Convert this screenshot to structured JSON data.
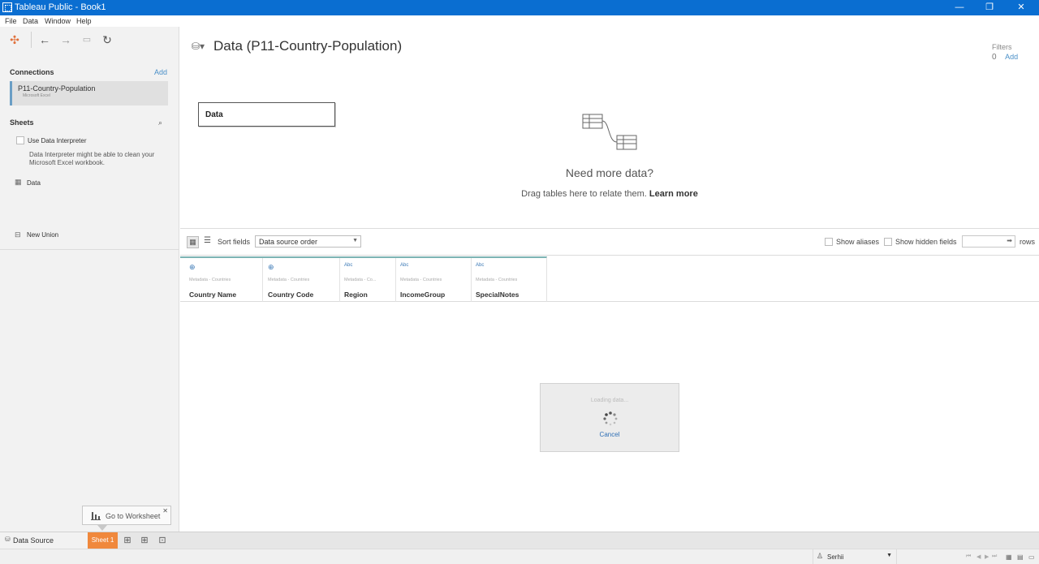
{
  "window": {
    "title": "Tableau Public - Book1",
    "minimize": "—",
    "restore": "❐",
    "close": "✕"
  },
  "menu": [
    "File",
    "Data",
    "Window",
    "Help"
  ],
  "left": {
    "connections_title": "Connections",
    "add_label": "Add",
    "connection": {
      "name": "P11-Country-Population",
      "type": "Microsoft Excel"
    },
    "sheets_title": "Sheets",
    "use_interpreter": "Use Data Interpreter",
    "interpreter_note_1": "Data Interpreter might be able to clean your",
    "interpreter_note_2": "Microsoft Excel workbook.",
    "sheet_item": "Data",
    "new_union": "New Union"
  },
  "goto_worksheet": "Go to Worksheet",
  "main": {
    "title": "Data (P11-Country-Population)",
    "filters_label": "Filters",
    "filters_count": "0",
    "filters_add": "Add",
    "canvas_table": "Data",
    "need_more_title": "Need more data?",
    "need_more_sub": "Drag tables here to relate them.",
    "learn_more": "Learn more"
  },
  "grid_toolbar": {
    "sort_label": "Sort fields",
    "sort_value": "Data source order",
    "show_aliases": "Show aliases",
    "show_hidden": "Show hidden fields",
    "rows_label": "rows"
  },
  "columns": [
    {
      "type": "globe",
      "meta": "Metadata - Countries",
      "name": "Country Name"
    },
    {
      "type": "globe",
      "meta": "Metadata - Countries",
      "name": "Country Code"
    },
    {
      "type": "Abc",
      "meta": "Metadata - Co...",
      "name": "Region"
    },
    {
      "type": "Abc",
      "meta": "Metadata - Countries",
      "name": "IncomeGroup"
    },
    {
      "type": "Abc",
      "meta": "Metadata - Countries",
      "name": "SpecialNotes"
    }
  ],
  "loading": {
    "text": "Loading data...",
    "cancel": "Cancel"
  },
  "tabs": {
    "data_source": "Data Source",
    "sheet1": "Sheet 1"
  },
  "status": {
    "user": "Serhii"
  },
  "colors": {
    "titlebar": "#0a6ed1",
    "sheet_tab": "#f0883c",
    "accent_link": "#4a90c8",
    "column_top": "#7db4b4"
  }
}
